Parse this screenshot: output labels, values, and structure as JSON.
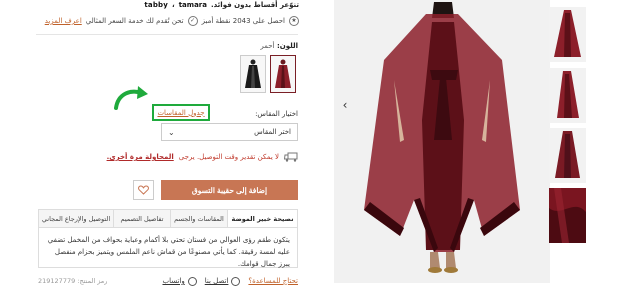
{
  "payments": {
    "headline": "تنوّعر أقساط بدون فوائد.",
    "tamara": "tamara",
    "tabby": "tabby"
  },
  "points": {
    "text": "احصل على 2043 نقطة أمبز",
    "service": "تحن تُقدم لك خدمة السعر المثالي",
    "learn_more": "اعرف المزيد"
  },
  "color": {
    "label": "اللون:",
    "value": "أحمر"
  },
  "size": {
    "label": "اختيار المقاس:",
    "guide": "جدول المقاسات",
    "select_placeholder": "اختر المقاس"
  },
  "delivery": {
    "message": "لا يمكن تقدير وقت التوصيل. يرجى",
    "retry": "المحاولة مرة أخرى."
  },
  "actions": {
    "add_to_bag": "إضافة إلى حقيبة التسوق"
  },
  "tabs": [
    {
      "label": "نصيحة خبير الموضة"
    },
    {
      "label": "المقاسات والجسم"
    },
    {
      "label": "تفاصيل التصميم"
    },
    {
      "label": "التوصيل والإرجاع المجاني"
    }
  ],
  "description": "يتكون طقم رؤى العوالي من فستان تحتي بلا أكمام وعباية بحواف من المخمل تضفي عليه لمسة رقيقة. كما يأتي مصنوعًا من قماش ناعم الملمس ويتميز بحزام منفصل يبرز جمال قوامك.",
  "help": {
    "question": "تحتاج للمساعدة؟",
    "call": "اتصل بنا",
    "whatsapp": "واتساب",
    "product_code": "رمز المنتج: 219127779"
  },
  "colors": {
    "accent": "#c87654",
    "garment": "#8c1f2a",
    "highlight": "#1faa3c"
  }
}
